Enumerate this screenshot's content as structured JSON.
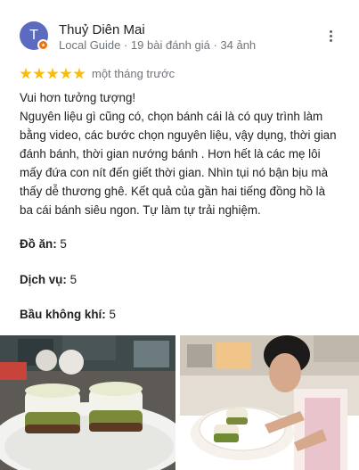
{
  "review": {
    "avatar_letter": "T",
    "author_name": "Thuỷ Diên Mai",
    "author_meta": "Local Guide · 19 bài đánh giá · 34 ảnh",
    "rating": 5,
    "rating_max": 5,
    "time_ago": "một tháng trước",
    "text_line_1": "Vui hơn tưởng tượng!",
    "text_body": "Nguyên liệu gì cũng có, chọn bánh cái là có quy trình làm bằng video, các bước chọn nguyên liệu, vậy dụng, thời gian đánh bánh, thời gian nướng bánh . Hơn hết là các mẹ lôi mấy đứa con nít đến giết thời gian. Nhìn tụi nó bận bịu mà thấy dễ thương ghê. Kết quả của gần hai tiếng đồng hồ là ba cái bánh siêu ngon. Tự làm tự trải nghiệm.",
    "attributes": [
      {
        "label": "Đồ ăn:",
        "value": "5"
      },
      {
        "label": "Dịch vụ:",
        "value": "5"
      },
      {
        "label": "Bầu không khí:",
        "value": "5"
      }
    ]
  },
  "icons": {
    "more": "more-vert-icon",
    "star": "star-icon",
    "local_guide_badge": "local-guide-badge-icon"
  },
  "colors": {
    "avatar": "#5c6bc0",
    "star": "#fbbc04",
    "badge": "#e8710a",
    "secondary_text": "#70757a"
  }
}
